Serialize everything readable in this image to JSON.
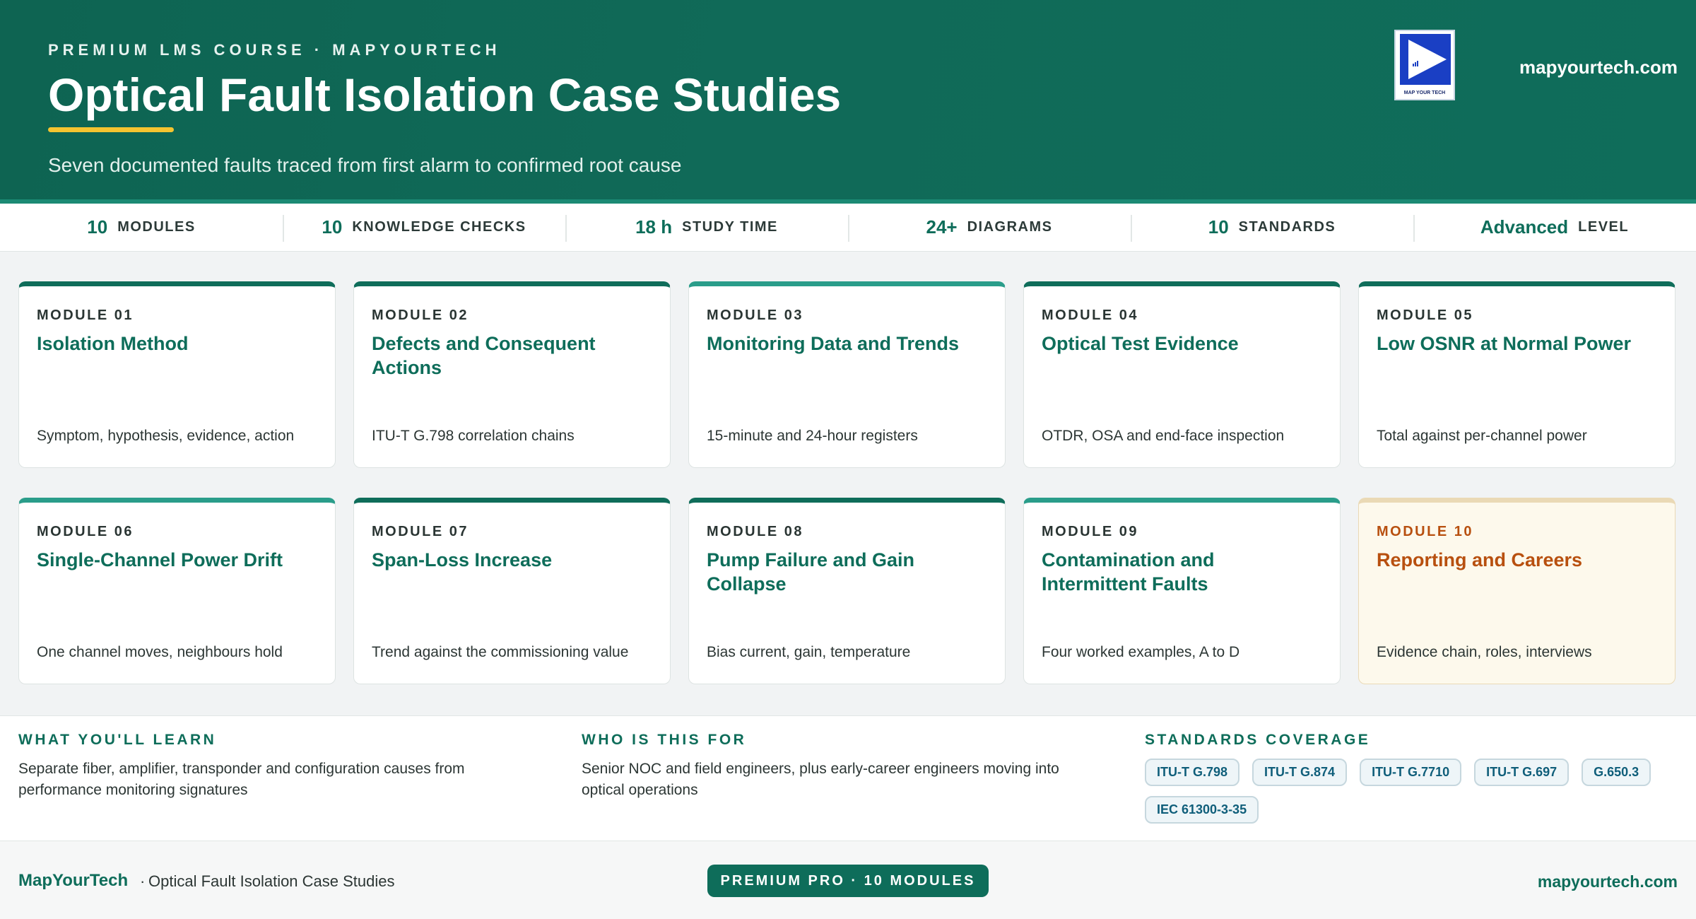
{
  "header": {
    "eyebrow": "PREMIUM LMS COURSE · MAPYOURTECH",
    "title": "Optical Fault Isolation Case Studies",
    "subtitle": "Seven documented faults traced from first alarm to confirmed root cause",
    "logo_text": "MAP YOUR TECH",
    "url": "mapyourtech.com"
  },
  "stats": [
    {
      "value": "10",
      "label": "MODULES"
    },
    {
      "value": "10",
      "label": "KNOWLEDGE CHECKS"
    },
    {
      "value": "18 h",
      "label": "STUDY TIME"
    },
    {
      "value": "24+",
      "label": "DIAGRAMS"
    },
    {
      "value": "10",
      "label": "STANDARDS"
    },
    {
      "value": "Advanced",
      "label": "LEVEL"
    }
  ],
  "modules": [
    {
      "num": "MODULE 01",
      "title": "Isolation Method",
      "desc": "Symptom, hypothesis, evidence, action"
    },
    {
      "num": "MODULE 02",
      "title": "Defects and Consequent Actions",
      "desc": "ITU-T G.798 correlation chains"
    },
    {
      "num": "MODULE 03",
      "title": "Monitoring Data and Trends",
      "desc": "15-minute and 24-hour registers"
    },
    {
      "num": "MODULE 04",
      "title": "Optical Test Evidence",
      "desc": "OTDR, OSA and end-face inspection"
    },
    {
      "num": "MODULE 05",
      "title": "Low OSNR at Normal Power",
      "desc": "Total against per-channel power"
    },
    {
      "num": "MODULE 06",
      "title": "Single-Channel Power Drift",
      "desc": "One channel moves, neighbours hold"
    },
    {
      "num": "MODULE 07",
      "title": "Span-Loss Increase",
      "desc": "Trend against the commissioning value"
    },
    {
      "num": "MODULE 08",
      "title": "Pump Failure and Gain Collapse",
      "desc": "Bias current, gain, temperature"
    },
    {
      "num": "MODULE 09",
      "title": "Contamination and Intermittent Faults",
      "desc": "Four worked examples, A to D"
    },
    {
      "num": "MODULE 10",
      "title": "Reporting and Careers",
      "desc": "Evidence chain, roles, interviews"
    }
  ],
  "info": {
    "learn": {
      "heading": "WHAT YOU'LL LEARN",
      "text": "Separate fiber, amplifier, transponder and configuration causes from performance monitoring signatures"
    },
    "audience": {
      "heading": "WHO IS THIS FOR",
      "text": "Senior NOC and field engineers, plus early-career engineers moving into optical operations"
    },
    "standards": {
      "heading": "STANDARDS COVERAGE",
      "items": [
        "ITU-T G.798",
        "ITU-T G.874",
        "ITU-T G.7710",
        "ITU-T G.697",
        "G.650.3",
        "IEC 61300-3-35"
      ]
    }
  },
  "footer": {
    "brand": "MapYourTech",
    "separator": "·",
    "course": "Optical Fault Isolation Case Studies",
    "badge": "PREMIUM PRO · 10 MODULES",
    "url": "mapyourtech.com"
  },
  "colors": {
    "primary": "#0e6d5a",
    "primary_light": "#2a9d8a",
    "accent": "#b8500f",
    "highlight": "#f4c430"
  }
}
